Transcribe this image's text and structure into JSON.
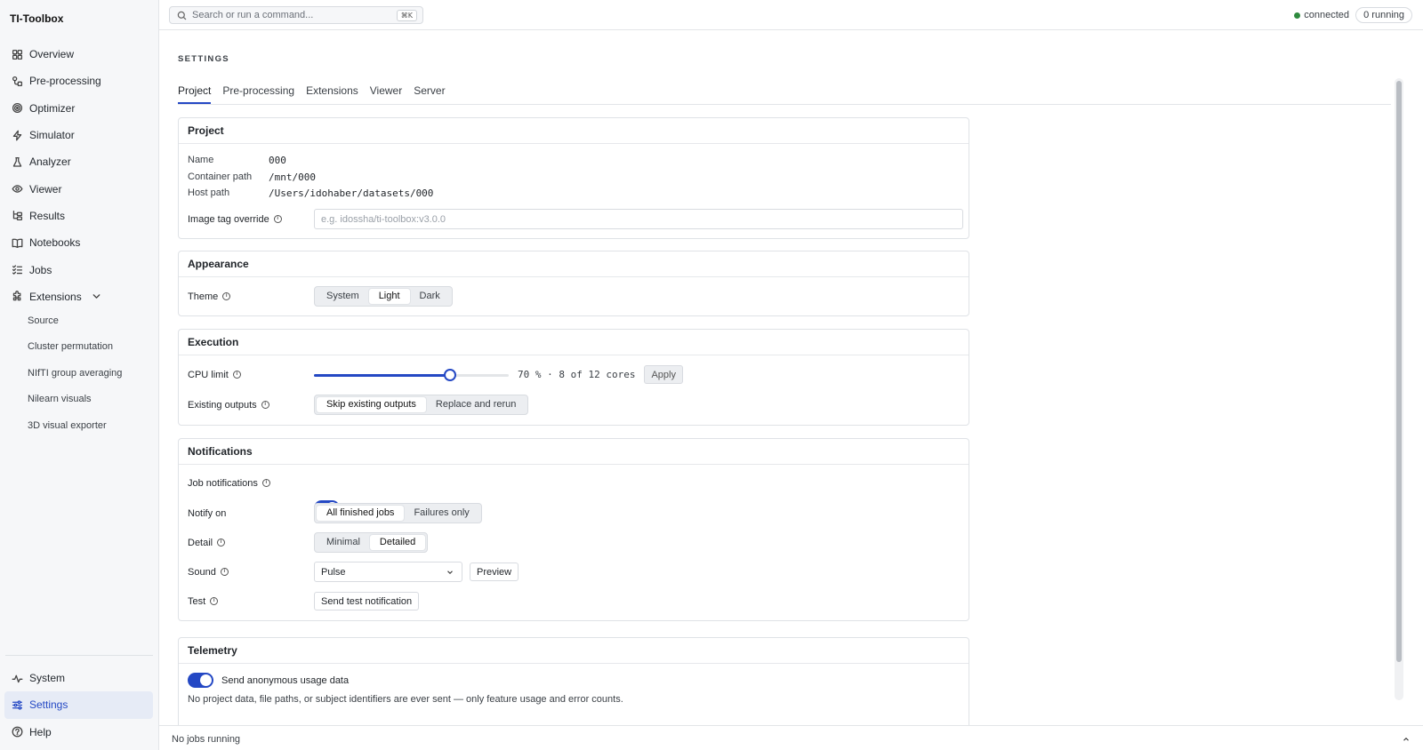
{
  "app": {
    "title": "TI-Toolbox"
  },
  "sidebar": {
    "items": [
      {
        "label": "Overview"
      },
      {
        "label": "Pre-processing"
      },
      {
        "label": "Optimizer"
      },
      {
        "label": "Simulator"
      },
      {
        "label": "Analyzer"
      },
      {
        "label": "Viewer"
      },
      {
        "label": "Results"
      },
      {
        "label": "Notebooks"
      },
      {
        "label": "Jobs"
      },
      {
        "label": "Extensions"
      }
    ],
    "extensions": [
      {
        "label": "Source"
      },
      {
        "label": "Cluster permutation"
      },
      {
        "label": "NIfTI group averaging"
      },
      {
        "label": "Nilearn visuals"
      },
      {
        "label": "3D visual exporter"
      }
    ],
    "bottom": [
      {
        "label": "System"
      },
      {
        "label": "Settings"
      },
      {
        "label": "Help"
      }
    ]
  },
  "topbar": {
    "search_placeholder": "Search or run a command...",
    "search_shortcut": "⌘K",
    "status": "connected",
    "running": "0 running"
  },
  "main": {
    "title": "SETTINGS",
    "tabs": [
      {
        "label": "Project"
      },
      {
        "label": "Pre-processing"
      },
      {
        "label": "Extensions"
      },
      {
        "label": "Viewer"
      },
      {
        "label": "Server"
      }
    ]
  },
  "project": {
    "title": "Project",
    "name_label": "Name",
    "name_value": "000",
    "container_label": "Container path",
    "container_value": "/mnt/000",
    "host_label": "Host path",
    "host_value": "/Users/idohaber/datasets/000",
    "image_tag_label": "Image tag override",
    "image_tag_placeholder": "e.g. idossha/ti-toolbox:v3.0.0"
  },
  "appearance": {
    "title": "Appearance",
    "theme_label": "Theme",
    "theme_options": [
      "System",
      "Light",
      "Dark"
    ],
    "theme_selected": "Light"
  },
  "execution": {
    "title": "Execution",
    "cpu_label": "CPU limit",
    "cpu_percent": 70,
    "cpu_text": "70 % · 8 of 12 cores",
    "apply_label": "Apply",
    "outputs_label": "Existing outputs",
    "outputs_options": [
      "Skip existing outputs",
      "Replace and rerun"
    ],
    "outputs_selected": "Skip existing outputs"
  },
  "notifications": {
    "title": "Notifications",
    "job_label": "Job notifications",
    "job_enabled": true,
    "notify_label": "Notify on",
    "notify_options": [
      "All finished jobs",
      "Failures only"
    ],
    "notify_selected": "All finished jobs",
    "detail_label": "Detail",
    "detail_options": [
      "Minimal",
      "Detailed"
    ],
    "detail_selected": "Detailed",
    "sound_label": "Sound",
    "sound_value": "Pulse",
    "preview_label": "Preview",
    "test_label": "Test",
    "test_button": "Send test notification"
  },
  "telemetry": {
    "title": "Telemetry",
    "enabled": true,
    "toggle_label": "Send anonymous usage data",
    "note": "No project data, file paths, or subject identifiers are ever sent — only feature usage and error counts."
  },
  "bottombar": {
    "text": "No jobs running"
  },
  "colors": {
    "accent": "#2448c4",
    "connected": "#2f8a3e",
    "sidebar_bg": "#f6f7f9"
  }
}
